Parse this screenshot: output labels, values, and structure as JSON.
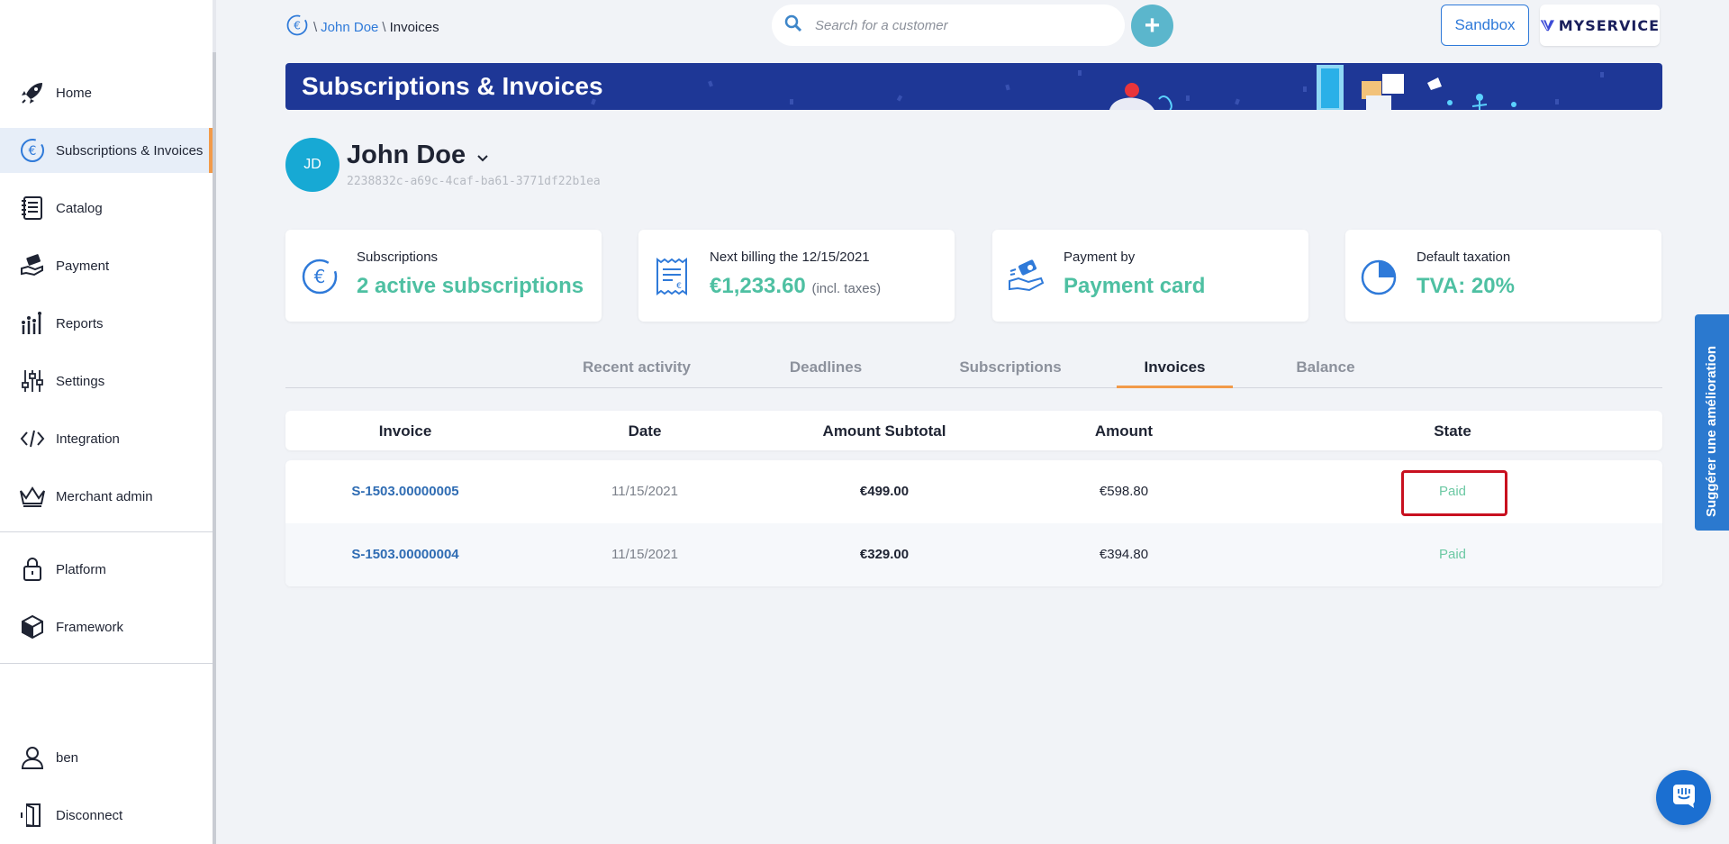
{
  "sidebar": {
    "items": [
      {
        "label": "Home",
        "icon": "rocket-icon"
      },
      {
        "label": "Subscriptions & Invoices",
        "icon": "euro-cycle-icon",
        "active": true
      },
      {
        "label": "Catalog",
        "icon": "notebook-icon"
      },
      {
        "label": "Payment",
        "icon": "hand-money-icon"
      },
      {
        "label": "Reports",
        "icon": "bar-chart-icon"
      },
      {
        "label": "Settings",
        "icon": "sliders-icon"
      },
      {
        "label": "Integration",
        "icon": "code-icon"
      },
      {
        "label": "Merchant admin",
        "icon": "crown-icon"
      },
      {
        "label": "Platform",
        "icon": "lock-icon"
      },
      {
        "label": "Framework",
        "icon": "cube-icon"
      },
      {
        "label": "ben",
        "icon": "user-icon"
      },
      {
        "label": "Disconnect",
        "icon": "door-icon"
      }
    ]
  },
  "header": {
    "breadcrumb": {
      "customer": "John Doe",
      "current": "Invoices",
      "separator": "\\"
    },
    "search_placeholder": "Search for a customer",
    "add_label": "+",
    "sandbox_label": "Sandbox",
    "brand_label": "MYSERVICE"
  },
  "banner": {
    "title": "Subscriptions & Invoices"
  },
  "customer": {
    "initials": "JD",
    "name": "John Doe",
    "id": "2238832c-a69c-4caf-ba61-3771df22b1ea"
  },
  "cards": [
    {
      "label": "Subscriptions",
      "value": "2 active subscriptions",
      "suffix": "",
      "icon": "euro-cycle-icon"
    },
    {
      "label": "Next billing the 12/15/2021",
      "value": "€1,233.60",
      "suffix": "(incl. taxes)",
      "icon": "receipt-icon"
    },
    {
      "label": "Payment by",
      "value": "Payment card",
      "suffix": "",
      "icon": "hand-card-icon"
    },
    {
      "label": "Default taxation",
      "value": "TVA: 20%",
      "suffix": "",
      "icon": "pie-chart-icon"
    }
  ],
  "tabs": [
    "Recent activity",
    "Deadlines",
    "Subscriptions",
    "Invoices",
    "Balance"
  ],
  "active_tab": "Invoices",
  "table": {
    "columns": [
      "Invoice",
      "Date",
      "Amount Subtotal",
      "Amount",
      "State"
    ],
    "rows": [
      {
        "invoice": "S-1503.00000005",
        "date": "11/15/2021",
        "subtotal": "€499.00",
        "amount": "€598.80",
        "state": "Paid"
      },
      {
        "invoice": "S-1503.00000004",
        "date": "11/15/2021",
        "subtotal": "€329.00",
        "amount": "€394.80",
        "state": "Paid"
      }
    ]
  },
  "suggest_label": "Suggérer une amélioration",
  "colors": {
    "accent": "#f29a49",
    "primary": "#2f7ad9",
    "banner": "#1e3796",
    "value_green": "#4ec0a2",
    "highlight": "#c8101f"
  }
}
